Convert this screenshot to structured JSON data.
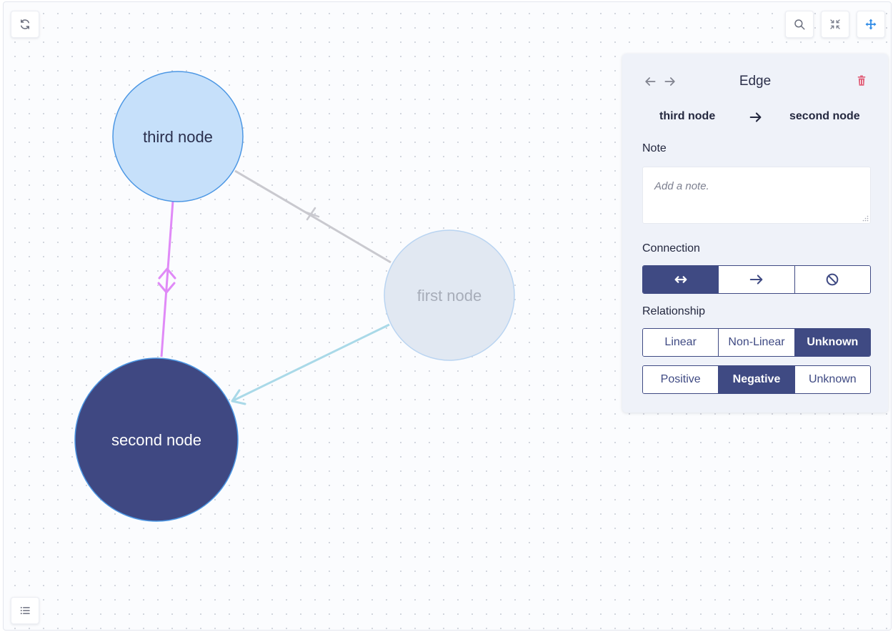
{
  "toolbar": {
    "refresh_icon": "refresh-icon",
    "search_icon": "search-icon",
    "collapse_icon": "collapse-icon",
    "move_icon": "move-icon",
    "list_icon": "list-icon",
    "move_active_color": "#2f8be6"
  },
  "graph": {
    "nodes": [
      {
        "id": "third",
        "label": "third node",
        "state": "selected-source",
        "fill": "#c6e0fa",
        "stroke": "#4c97e4",
        "text_color": "#2a2f4d"
      },
      {
        "id": "first",
        "label": "first node",
        "state": "faded",
        "fill": "#e1e8f2",
        "stroke": "#b9d4f1",
        "text_color": "#a7adb9"
      },
      {
        "id": "second",
        "label": "second node",
        "state": "selected-target",
        "fill": "#3f4882",
        "stroke": "#4c97e4",
        "text_color": "#ffffff"
      }
    ],
    "edges": [
      {
        "from": "third",
        "to": "second",
        "color": "#e08af7",
        "marker": "bidirectional-chevrons"
      },
      {
        "from": "third",
        "to": "first",
        "color": "#c9c9cf",
        "marker": "cross"
      },
      {
        "from": "first",
        "to": "second",
        "color": "#a9d9e8",
        "marker": "arrow"
      }
    ]
  },
  "panel": {
    "title": "Edge",
    "prev_icon": "arrow-left-icon",
    "next_icon": "arrow-right-icon",
    "delete_icon": "trash-icon",
    "delete_color": "#e0607a",
    "source": "third node",
    "target": "second node",
    "note_label": "Note",
    "note_placeholder": "Add a note.",
    "note_value": "",
    "connection_label": "Connection",
    "connection_options": [
      {
        "icon": "bidirectional-arrow-icon",
        "active": true
      },
      {
        "icon": "arrow-right-icon",
        "active": false
      },
      {
        "icon": "prohibited-icon",
        "active": false
      }
    ],
    "relationship_label": "Relationship",
    "linearity_options": [
      {
        "label": "Linear",
        "active": false
      },
      {
        "label": "Non-Linear",
        "active": false
      },
      {
        "label": "Unknown",
        "active": true
      }
    ],
    "polarity_options": [
      {
        "label": "Positive",
        "active": false
      },
      {
        "label": "Negative",
        "active": true
      },
      {
        "label": "Unknown",
        "active": false
      }
    ],
    "accent": "#3f4a83"
  }
}
